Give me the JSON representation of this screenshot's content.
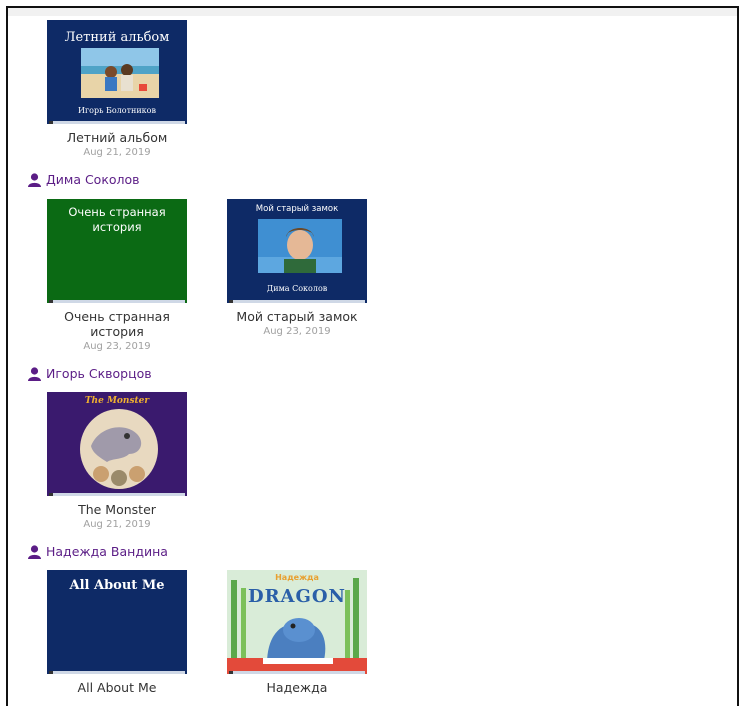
{
  "author_icon": "person-icon",
  "accent": "#5b1d86",
  "books": {
    "summer": {
      "cover_title": "Летний альбом",
      "cover_author": "Игорь Болотников",
      "title": "Летний альбом",
      "date": "Aug 21, 2019",
      "cover_color": "#0e2a66"
    },
    "strange": {
      "cover_title": "Очень странная история",
      "title": "Очень странная история",
      "date": "Aug 23, 2019",
      "cover_color": "#0b6a14"
    },
    "castle": {
      "cover_title": "Мой старый замок",
      "cover_author": "Дима Соколов",
      "title": "Мой старый замок",
      "date": "Aug 23, 2019",
      "cover_color": "#0e2a66"
    },
    "monster": {
      "cover_title": "The Monster",
      "title": "The Monster",
      "date": "Aug 21, 2019",
      "cover_color": "#3a1a6e"
    },
    "about": {
      "cover_title": "All About Me",
      "title": "All About Me",
      "cover_color": "#0e2a66"
    },
    "dragon": {
      "cover_top": "Надежда",
      "cover_title": "DRAGON",
      "title": "Надежда",
      "cover_color": "#cfe7f0"
    }
  },
  "authors": {
    "dima": "Дима Соколов",
    "igor": "Игорь Скворцов",
    "nadezhda": "Надежда Вандина"
  }
}
